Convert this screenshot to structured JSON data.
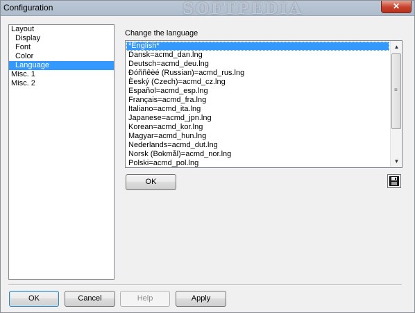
{
  "window": {
    "title": "Configuration",
    "watermark": "SOFTPEDIA",
    "close_glyph": "✕"
  },
  "tree": {
    "items": [
      {
        "label": "Layout",
        "level": 0
      },
      {
        "label": "Display",
        "level": 1
      },
      {
        "label": "Font",
        "level": 1
      },
      {
        "label": "Color",
        "level": 1
      },
      {
        "label": "Language",
        "level": 1,
        "selected": true
      },
      {
        "label": "Misc. 1",
        "level": 0
      },
      {
        "label": "Misc. 2",
        "level": 0
      }
    ]
  },
  "language": {
    "label": "Change the language",
    "items": [
      "*English*",
      "Dansk=acmd_dan.lng",
      "Deutsch=acmd_deu.lng",
      "Đóññêèé (Russian)=acmd_rus.lng",
      "Èeský (Czech)=acmd_cz.lng",
      "Español=acmd_esp.lng",
      "Français=acmd_fra.lng",
      "Italiano=acmd_ita.lng",
      "Japanese=acmd_jpn.lng",
      "Korean=acmd_kor.lng",
      "Magyar=acmd_hun.lng",
      "Nederlands=acmd_dut.lng",
      "Norsk (Bokmål)=acmd_nor.lng",
      "Polski=acmd_pol.lng"
    ],
    "selected_index": 0,
    "ok_label": "OK",
    "save_icon": "floppy-disk-icon"
  },
  "footer": {
    "ok_label": "OK",
    "cancel_label": "Cancel",
    "help_label": "Help",
    "apply_label": "Apply"
  },
  "colors": {
    "selection": "#3399ff",
    "window_bg": "#f0f0f0"
  }
}
